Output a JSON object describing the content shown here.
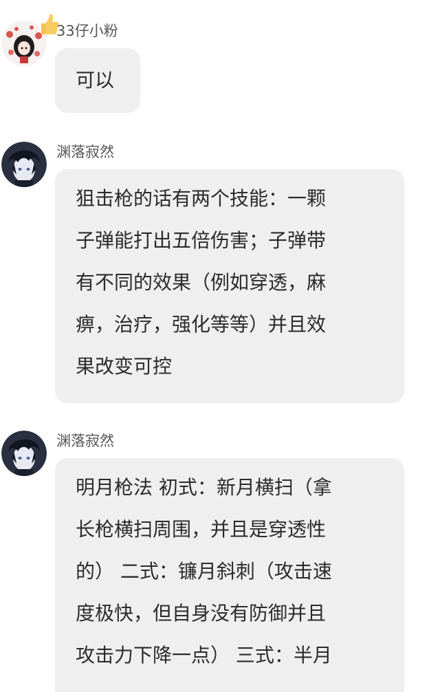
{
  "messages": [
    {
      "sender": "33仔小粉",
      "lines": [
        "可以"
      ]
    },
    {
      "sender": "渊落寂然",
      "lines": [
        "狙击枪的话有两个技能：一颗",
        "子弹能打出五倍伤害；子弹带",
        "有不同的效果（例如穿透，麻",
        "痹，治疗，强化等等）并且效",
        "果改变可控"
      ]
    },
    {
      "sender": "渊落寂然",
      "lines": [
        "明月枪法 初式：新月横扫（拿",
        "长枪横扫周围，并且是穿透性",
        "的） 二式：镰月斜刺（攻击速",
        "度极快，但自身没有防御并且",
        "攻击力下降一点） 三式：半月"
      ]
    }
  ],
  "colors": {
    "bubble": "#efefef",
    "text": "#2b2b2b",
    "name": "#555555",
    "background": "#ffffff"
  },
  "icons": {
    "badge": "thumbs-up-badge-icon",
    "avatar_1": "chibi-girl-avatar",
    "avatar_2": "anime-boy-avatar"
  }
}
